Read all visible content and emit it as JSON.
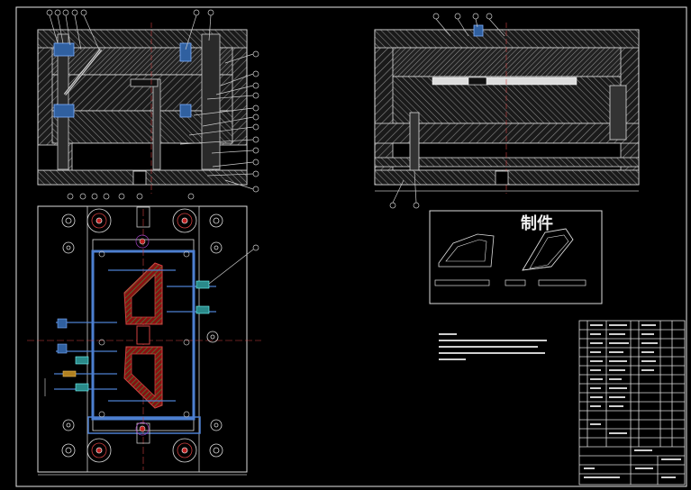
{
  "part_title": "制件"
}
